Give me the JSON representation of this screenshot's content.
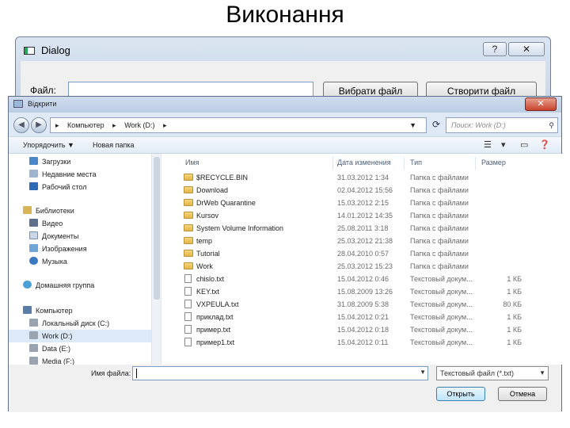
{
  "slide": {
    "title": "Виконання"
  },
  "dialog": {
    "title": "Dialog",
    "help_btn": "?",
    "close_btn": "✕",
    "file_label": "Файл:",
    "file_value": "",
    "choose_button": "Вибрати файл",
    "create_button": "Створити файл"
  },
  "open_dialog": {
    "title": "Відкрити",
    "close_btn": "✕",
    "address": [
      "Компьютер",
      "Work (D:)"
    ],
    "search_placeholder": "Поиск: Work (D:)",
    "toolbar": {
      "organize": "Упорядочить ▼",
      "new_folder": "Новая папка"
    },
    "sidebar": [
      {
        "label": "Загрузки",
        "icon": "downloads-icon"
      },
      {
        "label": "Недавние места",
        "icon": "recent-places-icon"
      },
      {
        "label": "Рабочий стол",
        "icon": "desktop-icon"
      },
      {
        "label": "Библиотеки",
        "icon": "libraries-icon"
      },
      {
        "label": "Видео",
        "icon": "video-icon"
      },
      {
        "label": "Документы",
        "icon": "documents-icon"
      },
      {
        "label": "Изображения",
        "icon": "images-icon"
      },
      {
        "label": "Музыка",
        "icon": "music-icon"
      },
      {
        "label": "Домашняя группа",
        "icon": "homegroup-icon"
      },
      {
        "label": "Компьютер",
        "icon": "computer-icon"
      },
      {
        "label": "Локальный диск (C:)",
        "icon": "drive-icon"
      },
      {
        "label": "Work (D:)",
        "icon": "drive-icon"
      },
      {
        "label": "Data (E:)",
        "icon": "drive-icon"
      },
      {
        "label": "Media (F:)",
        "icon": "drive-icon"
      }
    ],
    "columns": {
      "name": "Имя",
      "date": "Дата изменения",
      "type": "Тип",
      "size": "Размер"
    },
    "files": [
      {
        "name": "$RECYCLE.BIN",
        "date": "31.03.2012 1:34",
        "type": "Папка с файлами",
        "size": "",
        "kind": "folder"
      },
      {
        "name": "Download",
        "date": "02.04.2012 15:56",
        "type": "Папка с файлами",
        "size": "",
        "kind": "folder"
      },
      {
        "name": "DrWeb Quarantine",
        "date": "15.03.2012 2:15",
        "type": "Папка с файлами",
        "size": "",
        "kind": "folder"
      },
      {
        "name": "Kursov",
        "date": "14.01.2012 14:35",
        "type": "Папка с файлами",
        "size": "",
        "kind": "folder"
      },
      {
        "name": "System Volume Information",
        "date": "25.08.2011 3:18",
        "type": "Папка с файлами",
        "size": "",
        "kind": "folder"
      },
      {
        "name": "temp",
        "date": "25.03.2012 21:38",
        "type": "Папка с файлами",
        "size": "",
        "kind": "folder"
      },
      {
        "name": "Tutorial",
        "date": "28.04.2010 0:57",
        "type": "Папка с файлами",
        "size": "",
        "kind": "folder"
      },
      {
        "name": "Work",
        "date": "25.03.2012 15:23",
        "type": "Папка с файлами",
        "size": "",
        "kind": "folder"
      },
      {
        "name": "chislo.txt",
        "date": "15.04.2012 0:46",
        "type": "Текстовый докум...",
        "size": "1 КБ",
        "kind": "file"
      },
      {
        "name": "KEY.txt",
        "date": "15.08.2009 13:26",
        "type": "Текстовый докум...",
        "size": "1 КБ",
        "kind": "file"
      },
      {
        "name": "VXPEULA.txt",
        "date": "31.08.2009 5:38",
        "type": "Текстовый докум...",
        "size": "80 КБ",
        "kind": "file"
      },
      {
        "name": "приклад.txt",
        "date": "15.04.2012 0:21",
        "type": "Текстовый докум...",
        "size": "1 КБ",
        "kind": "file"
      },
      {
        "name": "пример.txt",
        "date": "15.04.2012 0:18",
        "type": "Текстовый докум...",
        "size": "1 КБ",
        "kind": "file"
      },
      {
        "name": "пример1.txt",
        "date": "15.04.2012 0:11",
        "type": "Текстовый докум...",
        "size": "1 КБ",
        "kind": "file"
      }
    ],
    "filename_label": "Имя файла:",
    "filename_value": "",
    "filetype": "Текстовый файл (*.txt)",
    "open_button": "Открыть",
    "cancel_button": "Отмена"
  }
}
